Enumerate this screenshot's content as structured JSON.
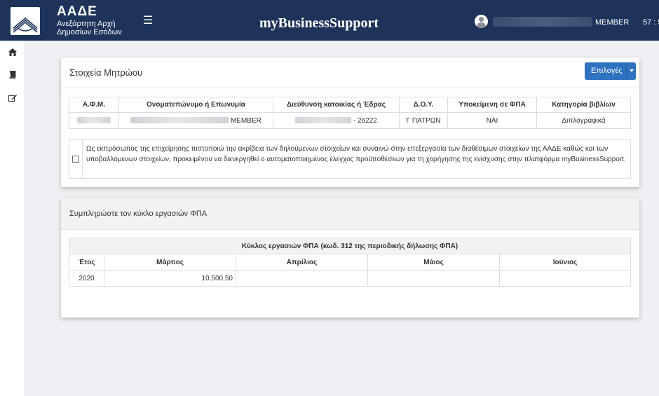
{
  "header": {
    "org_short": "ΑΑΔΕ",
    "org_line1": "Ανεξάρτητη Αρχή",
    "org_line2": "Δημοσίων Εσόδων",
    "menu_icon": "menu-icon",
    "app_title": "myBusinessSupport",
    "user_role": "MEMBER",
    "timer": "57 : 5",
    "colors": {
      "bar": "#1d3359",
      "accent": "#2e73c0"
    }
  },
  "sidebar": {
    "items": [
      {
        "icon": "home-icon"
      },
      {
        "icon": "book-icon"
      },
      {
        "icon": "edit-icon"
      }
    ]
  },
  "registry": {
    "title": "Στοιχεία Μητρώου",
    "options_label": "Επιλογές",
    "columns": [
      "Α.Φ.Μ.",
      "Ονοματεπώνυμο ή Επωνυμία",
      "Διεύθυνση κατοικίας ή Έδρας",
      "Δ.Ο.Υ.",
      "Υποκείμενη σε ΦΠΑ",
      "Κατηγορία βιβλίων"
    ],
    "row": {
      "name_suffix": "MEMBER",
      "address_suffix": "- 26222",
      "doy": "Γ ΠΑΤΡΩΝ",
      "vat": "ΝΑΙ",
      "books": "Διπλογραφικά"
    },
    "consent_text": "Ως εκπρόσωπος της επιχείρησης πιστοποιώ την ακρίβεια των δηλούμενων στοιχείων και συναινώ στην επεξεργασία των διαθέσιμων στοιχείων της ΑΑΔΕ καθώς και των υποβαλλόμενων στοιχείων, προκειμένου να διενεργηθεί ο αυτοματοποιημένος έλεγχος προϋποθέσεων για τη χορήγησης της ενίσχυσης στην πλατφόρμα myBusinessSupport."
  },
  "vat_cycle": {
    "title": "Συμπληρώστε τον κύκλο εργασιών ΦΠΑ",
    "caption": "Κύκλος εργασιών ΦΠΑ (κωδ. 312 της περιοδικής δήλωσης ΦΠΑ)",
    "columns": [
      "Έτος",
      "Μάρτιος",
      "Απρίλιος",
      "Μάιος",
      "Ιούνιος"
    ],
    "row": {
      "year": "2020",
      "march": "10.500,50",
      "april": "",
      "may": "",
      "june": ""
    }
  }
}
